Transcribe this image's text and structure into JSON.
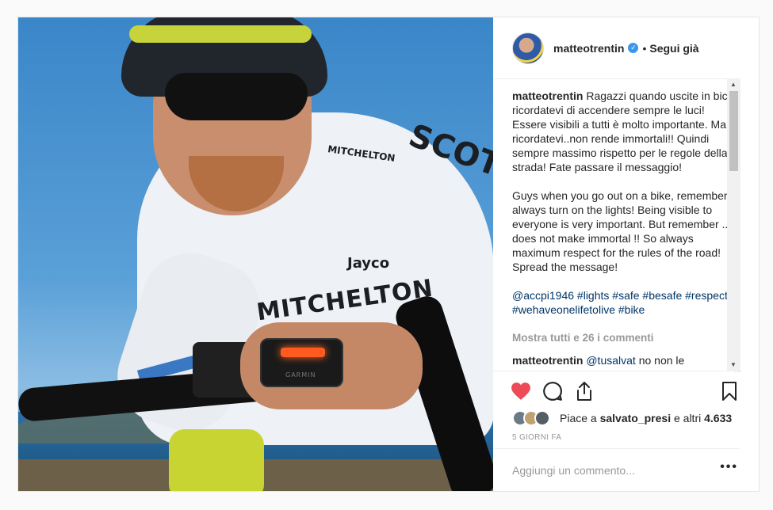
{
  "post": {
    "username": "matteotrentin",
    "follow_status": "Segui già",
    "separator": "•",
    "photo_texts": {
      "jersey_main": "MITCHELTON",
      "jersey_brand": "SCOTT",
      "jersey_sponsor": "Jayco",
      "device_brand": "GARMIN"
    }
  },
  "caption": {
    "username": "matteotrentin",
    "text_it": " Ragazzi quando uscite in bici ricordatevi di accendere sempre le luci! Essere visibili a tutti è molto importante. Ma ricordatevi..non rende immortali!! Quindi sempre massimo rispetto per le regole della strada! Fate passare il messaggio!",
    "text_en": "Guys when you go out on a bike, remember to always turn on the lights! Being visible to everyone is very important. But remember .. it does not make immortal !! So always maximum respect for the rules of the road! Spread the message!",
    "tags": "@accpi1946 #lights #safe #besafe #respect #wehaveonelifetolive #bike"
  },
  "comments": {
    "show_all": "Mostra tutti e 26 i commenti",
    "first": {
      "username": "matteotrentin",
      "mention": "@tusalvat",
      "text": " no non le"
    }
  },
  "likes": {
    "prefix": "Piace a ",
    "user": "salvato_presi",
    "middle": " e altri ",
    "count": "4.633"
  },
  "time": "5 GIORNI FA",
  "add_comment": {
    "placeholder": "Aggiungi un commento...",
    "more_label": "•••"
  },
  "colors": {
    "like_red": "#ed4956",
    "link_blue": "#003569",
    "verified_blue": "#3897f0"
  },
  "icons": [
    "heart-icon",
    "comment-icon",
    "share-icon",
    "bookmark-icon",
    "verified-icon"
  ]
}
